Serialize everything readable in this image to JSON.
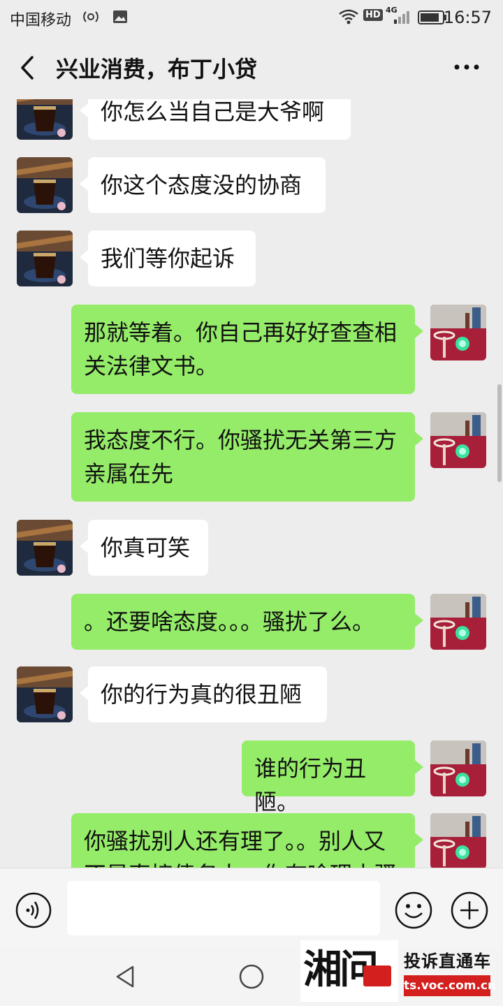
{
  "status_bar": {
    "carrier": "中国移动",
    "time": "16:57",
    "network_badge": "HD",
    "signal_label": "4G"
  },
  "header": {
    "title": "兴业消费，布丁小贷"
  },
  "messages": [
    {
      "side": "left",
      "text": "你怎么当自己是大爷啊"
    },
    {
      "side": "left",
      "text": "你这个态度没的协商"
    },
    {
      "side": "left",
      "text": "我们等你起诉"
    },
    {
      "side": "right",
      "text": "那就等着。你自己再好好查查相关法律文书。"
    },
    {
      "side": "right",
      "text": "我态度不行。你骚扰无关第三方亲属在先"
    },
    {
      "side": "left",
      "text": "你真可笑"
    },
    {
      "side": "right",
      "text": "。还要啥态度。。。骚扰了么。"
    },
    {
      "side": "left",
      "text": "你的行为真的很丑陋"
    },
    {
      "side": "right",
      "text": "谁的行为丑陋。"
    },
    {
      "side": "right",
      "text": "你骚扰别人还有理了。。别人又不是直接债务人，你有啥理由骚"
    }
  ],
  "input_bar": {
    "text_value": ""
  },
  "watermark": {
    "logo_text": "湘问",
    "name": "投诉直通车",
    "url": "ts.voc.com.cn"
  },
  "colors": {
    "background": "#ededed",
    "incoming_bubble": "#ffffff",
    "outgoing_bubble": "#95ec69",
    "watermark_red": "#d41f1f"
  },
  "icons": {
    "back": "chevron-left-icon",
    "more": "more-dots-icon",
    "voice": "voice-icon",
    "emoji": "emoji-icon",
    "plus": "plus-icon"
  }
}
